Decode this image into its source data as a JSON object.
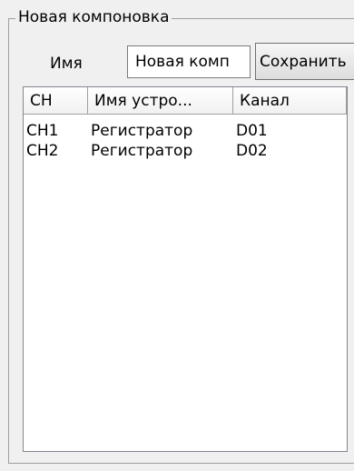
{
  "group": {
    "title": "Новая компоновка"
  },
  "form": {
    "name_label": "Имя",
    "name_value": "Новая комп",
    "save_label": "Сохранить"
  },
  "table": {
    "columns": [
      "CH",
      "Имя устро...",
      "Канал"
    ],
    "rows": [
      [
        "CH1",
        "Регистратор",
        "D01"
      ],
      [
        "CH2",
        "Регистратор",
        "D02"
      ]
    ]
  }
}
